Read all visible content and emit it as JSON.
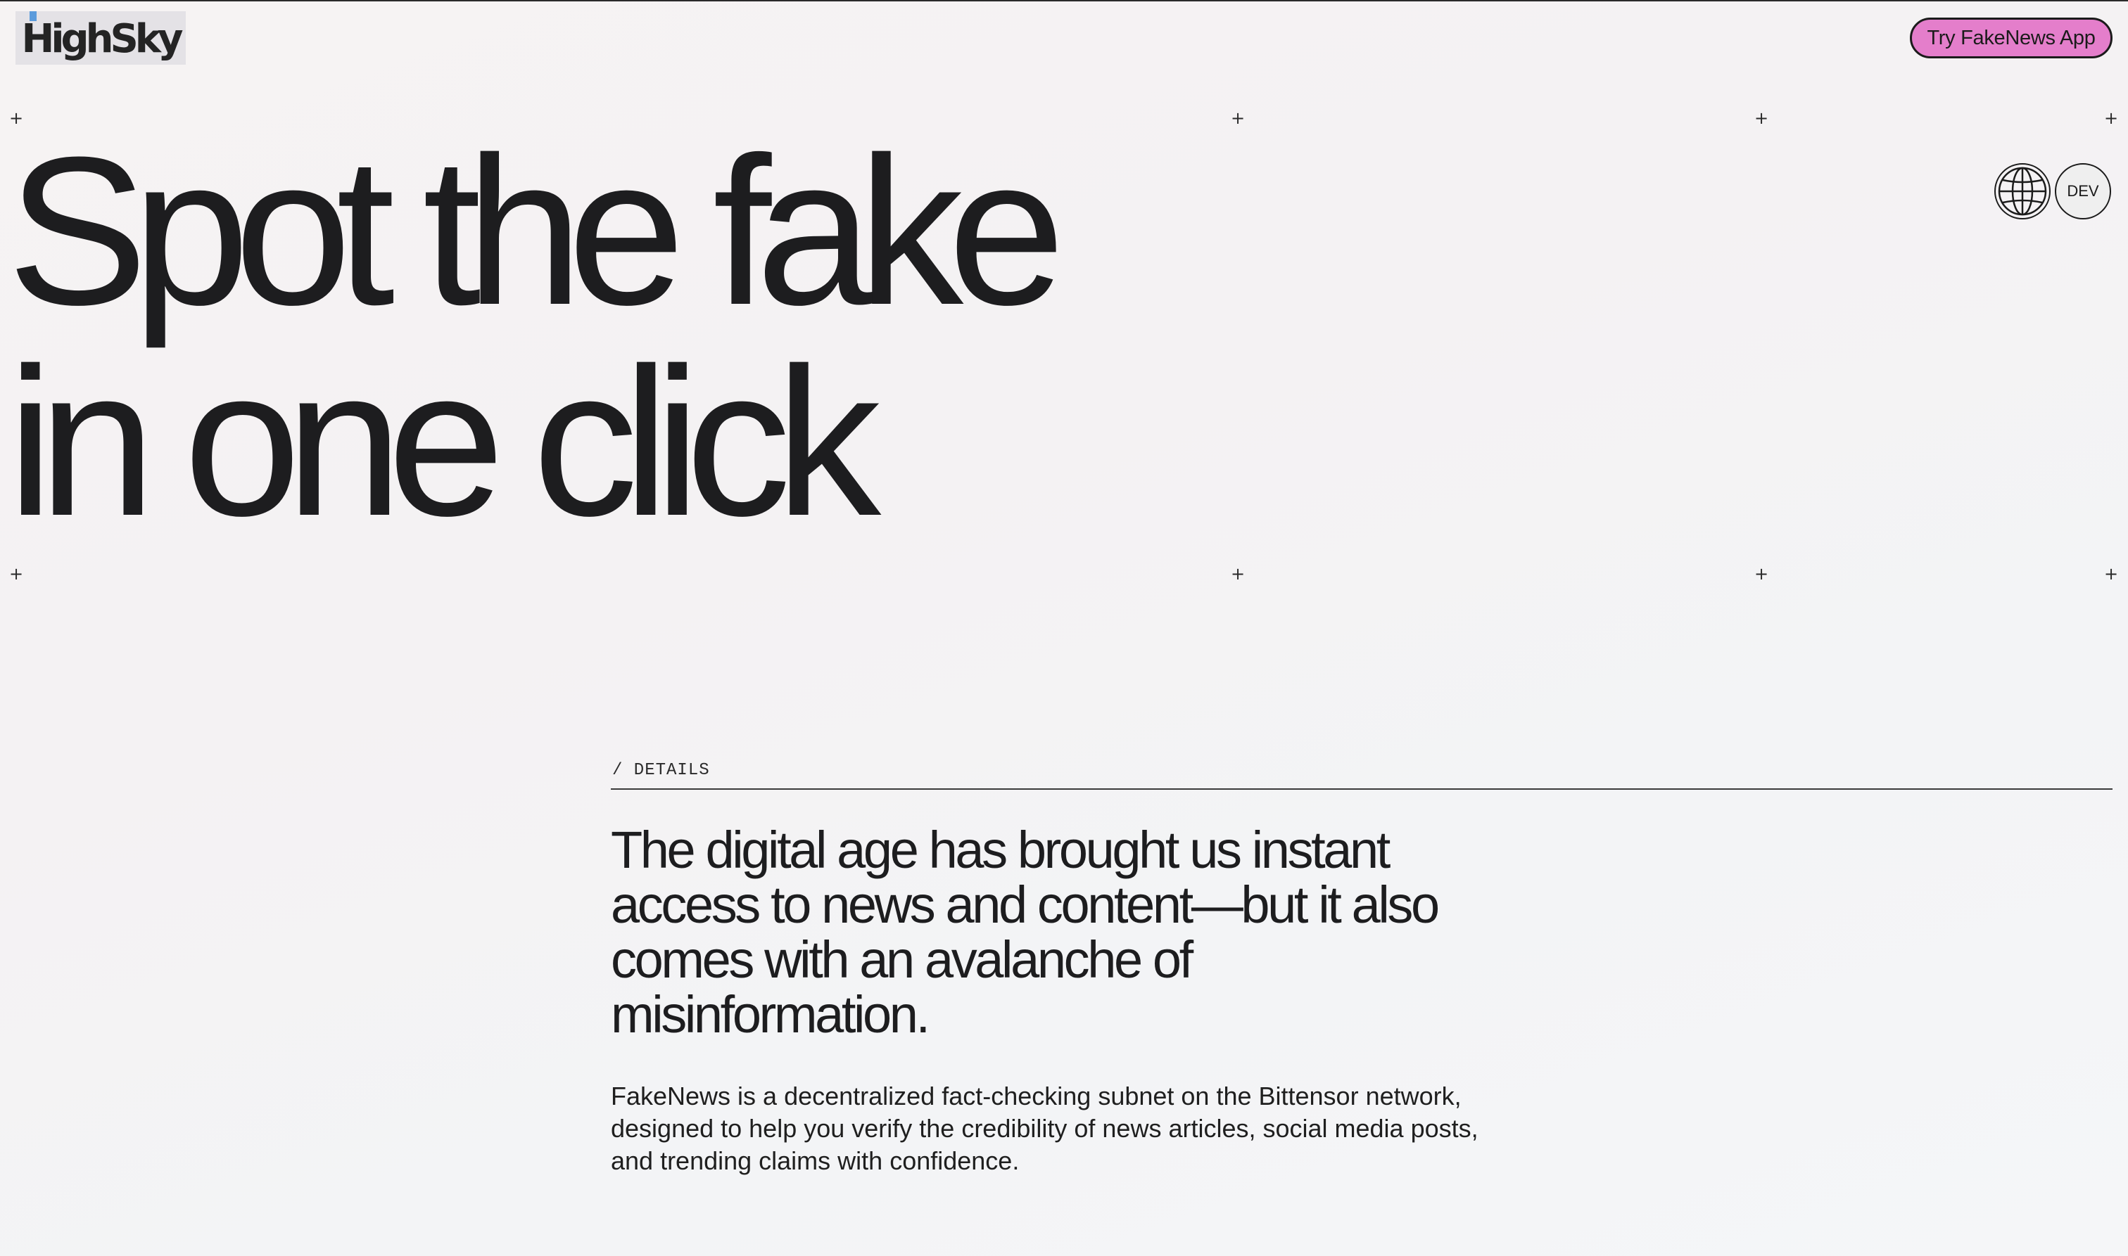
{
  "header": {
    "logo_text": "HighSky",
    "cta_label": "Try FakeNews App"
  },
  "hero": {
    "line1": "Spot the fake",
    "line2": "in one click"
  },
  "controls": {
    "language_icon": "globe-icon",
    "env_label": "DEV"
  },
  "details": {
    "section_label": "/ DETAILS",
    "lead": "The digital age has brought us instant access to news and content—but it also comes with an avalanche of misinformation.",
    "body": "FakeNews is a decentralized fact-checking subnet on the Bittensor network, designed to help you verify the credibility of news articles, social media posts, and trending claims with confidence."
  },
  "colors": {
    "accent": "#e47ecb",
    "text": "#1d1d1f",
    "logo_mark": "#5b9bdc"
  }
}
